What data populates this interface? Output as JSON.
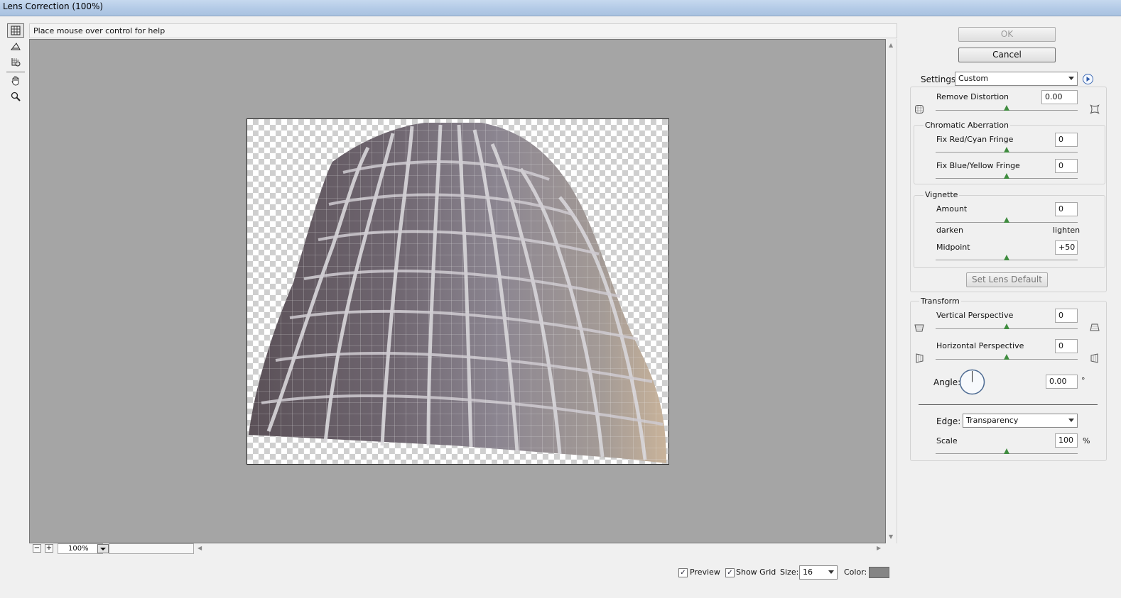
{
  "window": {
    "title": "Lens Correction (100%)"
  },
  "help": {
    "text": "Place mouse over control for help"
  },
  "zoom": {
    "value": "100%",
    "minus": "−",
    "plus": "+"
  },
  "bottom": {
    "preview_label": "Preview",
    "preview_checked": true,
    "grid_label": "Show Grid",
    "grid_checked": true,
    "size_label": "Size:",
    "size_value": "16",
    "color_label": "Color:",
    "grid_color": "#858585"
  },
  "panel": {
    "ok_label": "OK",
    "cancel_label": "Cancel",
    "settings_label": "Settings:",
    "settings_value": "Custom",
    "remove_distortion": {
      "label": "Remove Distortion",
      "value": "0.00"
    },
    "chromatic": {
      "title": "Chromatic Aberration",
      "red_cyan": {
        "label": "Fix Red/Cyan Fringe",
        "value": "0"
      },
      "blue_yellow": {
        "label": "Fix Blue/Yellow Fringe",
        "value": "0"
      }
    },
    "vignette": {
      "title": "Vignette",
      "amount": {
        "label": "Amount",
        "value": "0"
      },
      "darken": "darken",
      "lighten": "lighten",
      "midpoint": {
        "label": "Midpoint",
        "value": "+50"
      }
    },
    "set_lens_default": "Set Lens Default",
    "transform": {
      "title": "Transform",
      "vertical": {
        "label": "Vertical Perspective",
        "value": "0"
      },
      "horizontal": {
        "label": "Horizontal Perspective",
        "value": "0"
      },
      "angle": {
        "label": "Angle:",
        "value": "0.00",
        "unit": "°"
      },
      "edge": {
        "label": "Edge:",
        "value": "Transparency"
      },
      "scale": {
        "label": "Scale",
        "value": "100",
        "unit": "%"
      }
    }
  }
}
